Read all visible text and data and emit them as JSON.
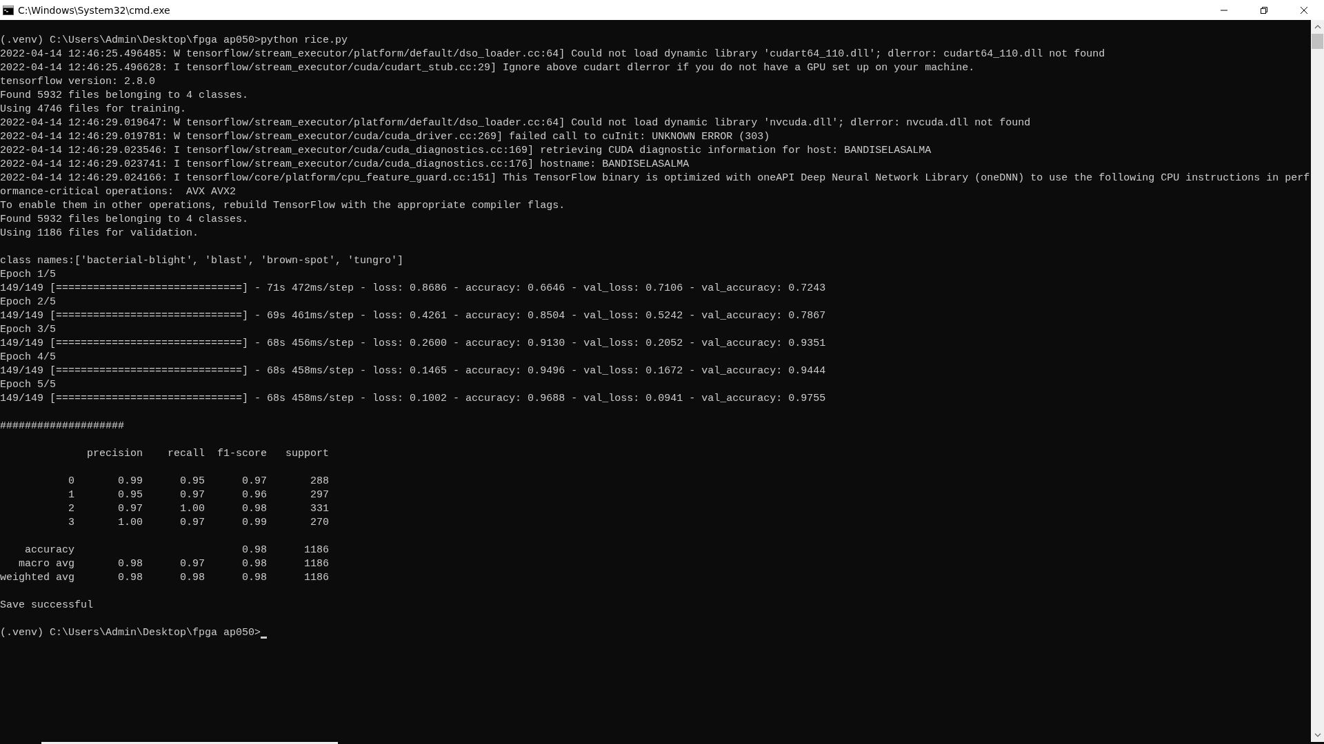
{
  "window": {
    "title": "C:\\Windows\\System32\\cmd.exe"
  },
  "output_blocks": [
    [
      "(.venv) C:\\Users\\Admin\\Desktop\\fpga ap050>python rice.py",
      "2022-04-14 12:46:25.496485: W tensorflow/stream_executor/platform/default/dso_loader.cc:64] Could not load dynamic library 'cudart64_110.dll'; dlerror: cudart64_110.dll not found",
      "2022-04-14 12:46:25.496628: I tensorflow/stream_executor/cuda/cudart_stub.cc:29] Ignore above cudart dlerror if you do not have a GPU set up on your machine.",
      "tensorflow version: 2.8.0",
      "Found 5932 files belonging to 4 classes.",
      "Using 4746 files for training.",
      "2022-04-14 12:46:29.019647: W tensorflow/stream_executor/platform/default/dso_loader.cc:64] Could not load dynamic library 'nvcuda.dll'; dlerror: nvcuda.dll not found",
      "2022-04-14 12:46:29.019781: W tensorflow/stream_executor/cuda/cuda_driver.cc:269] failed call to cuInit: UNKNOWN ERROR (303)",
      "2022-04-14 12:46:29.023546: I tensorflow/stream_executor/cuda/cuda_diagnostics.cc:169] retrieving CUDA diagnostic information for host: BANDISELASALMA",
      "2022-04-14 12:46:29.023741: I tensorflow/stream_executor/cuda/cuda_diagnostics.cc:176] hostname: BANDISELASALMA",
      "2022-04-14 12:46:29.024166: I tensorflow/core/platform/cpu_feature_guard.cc:151] This TensorFlow binary is optimized with oneAPI Deep Neural Network Library (oneDNN) to use the following CPU instructions in perf",
      "ormance-critical operations:  AVX AVX2",
      "To enable them in other operations, rebuild TensorFlow with the appropriate compiler flags.",
      "Found 5932 files belonging to 4 classes.",
      "Using 1186 files for validation."
    ],
    [
      "class names:['bacterial-blight', 'blast', 'brown-spot', 'tungro']",
      "Epoch 1/5",
      "149/149 [==============================] - 71s 472ms/step - loss: 0.8686 - accuracy: 0.6646 - val_loss: 0.7106 - val_accuracy: 0.7243",
      "Epoch 2/5",
      "149/149 [==============================] - 69s 461ms/step - loss: 0.4261 - accuracy: 0.8504 - val_loss: 0.5242 - val_accuracy: 0.7867",
      "Epoch 3/5",
      "149/149 [==============================] - 68s 456ms/step - loss: 0.2600 - accuracy: 0.9130 - val_loss: 0.2052 - val_accuracy: 0.9351",
      "Epoch 4/5",
      "149/149 [==============================] - 68s 458ms/step - loss: 0.1465 - accuracy: 0.9496 - val_loss: 0.1672 - val_accuracy: 0.9444",
      "Epoch 5/5",
      "149/149 [==============================] - 68s 458ms/step - loss: 0.1002 - accuracy: 0.9688 - val_loss: 0.0941 - val_accuracy: 0.9755"
    ],
    [
      "####################"
    ],
    [
      "              precision    recall  f1-score   support"
    ],
    [
      "           0       0.99      0.95      0.97       288",
      "           1       0.95      0.97      0.96       297",
      "           2       0.97      1.00      0.98       331",
      "           3       1.00      0.97      0.99       270"
    ],
    [
      "    accuracy                           0.98      1186",
      "   macro avg       0.98      0.97      0.98      1186",
      "weighted avg       0.98      0.98      0.98      1186"
    ],
    [
      "Save successful"
    ]
  ],
  "prompt": "(.venv) C:\\Users\\Admin\\Desktop\\fpga ap050>"
}
